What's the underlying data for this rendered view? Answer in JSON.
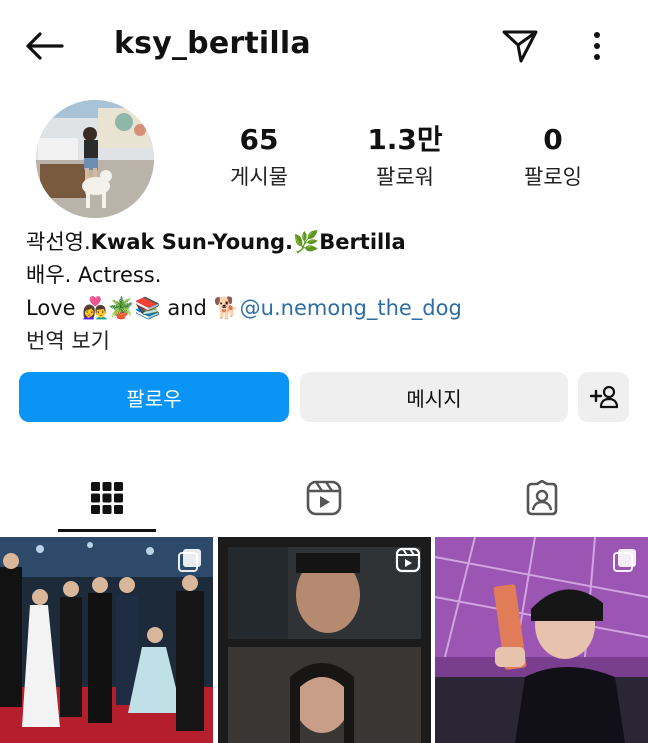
{
  "header": {
    "username": "ksy_bertilla",
    "back_icon": "arrow-left-icon",
    "send_icon": "paper-plane-icon",
    "more_icon": "vertical-dots-icon"
  },
  "stats": [
    {
      "value": "65",
      "label": "게시물"
    },
    {
      "value": "1.3만",
      "label": "팔로워"
    },
    {
      "value": "0",
      "label": "팔로잉"
    }
  ],
  "bio": {
    "name_line": {
      "prefix": "곽선영.",
      "name": "Kwak Sun-Young.",
      "emoji": "🌿",
      "suffix": "Bertilla"
    },
    "line2": "배우. Actress.",
    "line3": {
      "prefix": "Love ",
      "emojis": "👩‍❤️‍👨🪴📚",
      "mid": " and ",
      "dog_emoji": "🐕",
      "mention": "@u.nemong_the_dog"
    },
    "translate": "번역 보기"
  },
  "actions": {
    "follow": "팔로우",
    "message": "메시지",
    "add_user_icon": "person-plus-icon"
  },
  "tabs": [
    {
      "icon": "grid-icon",
      "active": true
    },
    {
      "icon": "reels-icon",
      "active": false
    },
    {
      "icon": "tagged-user-icon",
      "active": false
    }
  ],
  "posts": [
    {
      "type": "carousel",
      "badge_icon": "carousel-icon"
    },
    {
      "type": "reel",
      "badge_icon": "reels-play-icon"
    },
    {
      "type": "carousel",
      "badge_icon": "carousel-icon"
    }
  ],
  "colors": {
    "accent": "#0a95f6",
    "secondary_button": "#efefef",
    "mention": "#2f6ea3",
    "text": "#111111"
  }
}
